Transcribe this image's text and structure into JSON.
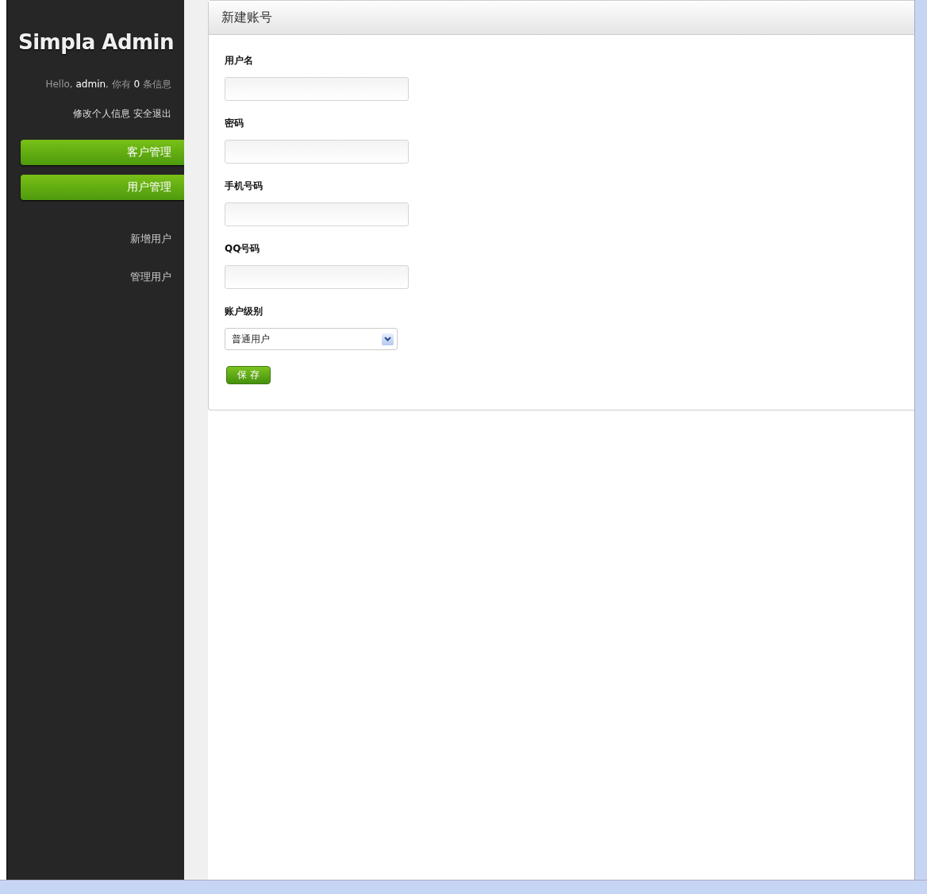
{
  "sidebar": {
    "title": "Simpla Admin",
    "greeting": {
      "prefix": "Hello, ",
      "user": "admin",
      "middle": ", 你有 ",
      "count": "0",
      "suffix": "条信息"
    },
    "links": [
      "修改个人信息",
      "安全退出"
    ],
    "nav": [
      {
        "label": "客户管理"
      },
      {
        "label": "用户管理"
      }
    ],
    "subnav": [
      {
        "label": "新增用户"
      },
      {
        "label": "管理用户"
      }
    ]
  },
  "form": {
    "title": "新建账号",
    "fields": [
      {
        "kind": "input",
        "label": "用户名"
      },
      {
        "kind": "input",
        "label": "密码"
      },
      {
        "kind": "input",
        "label": "手机号码"
      },
      {
        "kind": "input",
        "label": "QQ号码"
      },
      {
        "kind": "select",
        "label": "账户级别",
        "value": "普通用户"
      }
    ],
    "submit": "保 存"
  }
}
